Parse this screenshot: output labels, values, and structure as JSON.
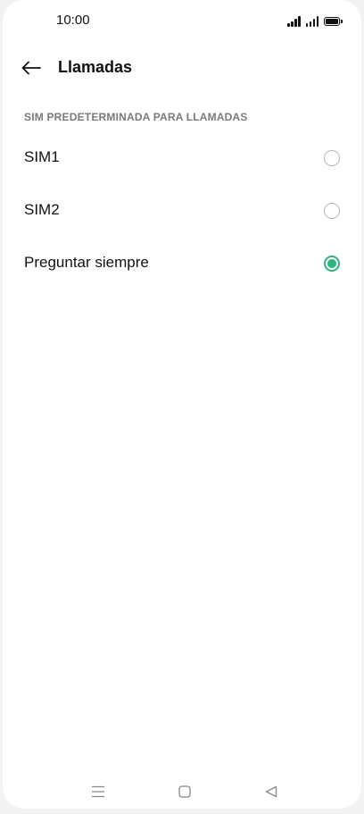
{
  "status_bar": {
    "time": "10:00",
    "icons": [
      "signal-sim1-icon",
      "signal-sim2-icon",
      "battery-icon"
    ]
  },
  "app_bar": {
    "back_icon": "arrow-left-icon",
    "title": "Llamadas"
  },
  "section": {
    "header": "SIM PREDETERMINADA PARA LLAMADAS",
    "options": [
      {
        "label": "SIM1",
        "selected": false
      },
      {
        "label": "SIM2",
        "selected": false
      },
      {
        "label": "Preguntar siempre",
        "selected": true
      }
    ]
  },
  "nav_bar": {
    "icons": [
      "menu-icon",
      "home-icon",
      "back-triangle-icon"
    ]
  },
  "colors": {
    "accent": "#2ab57d",
    "radio_unselected": "#b5b5b5",
    "section_header": "#7a7a7a"
  }
}
